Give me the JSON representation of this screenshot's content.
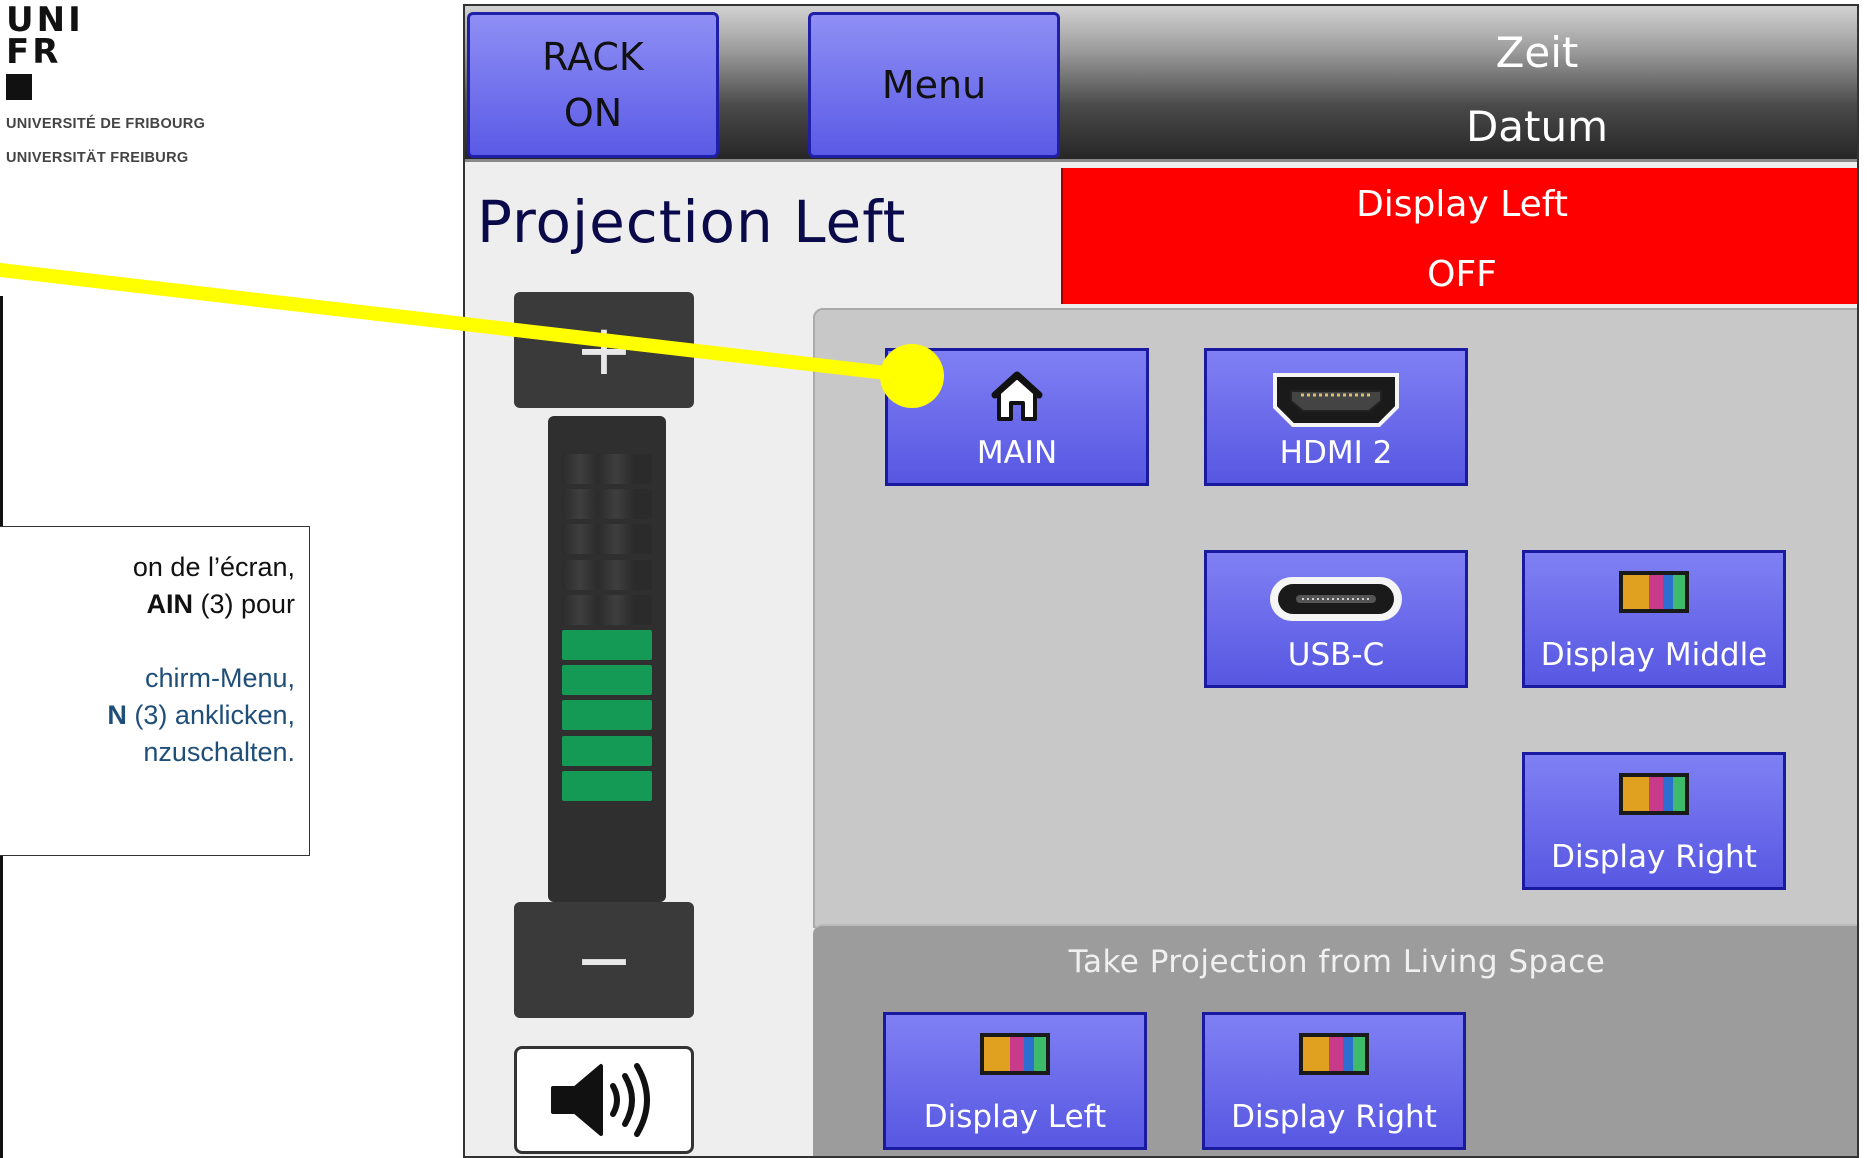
{
  "logo": {
    "wordmark_line1": "UNI",
    "wordmark_line2": "FR",
    "university_fr": "UNIVERSITÉ DE FRIBOURG",
    "university_de": "UNIVERSITÄT FREIBURG"
  },
  "note": {
    "fr_line1": "on de l’écran,",
    "fr_line2_bold": "AIN",
    "fr_line2_rest": " (3) pour",
    "de_line1": "chirm-Menu,",
    "de_line2_bold": "N",
    "de_line2_rest": " (3) anklicken,",
    "de_line3": "nzuschalten."
  },
  "topbar": {
    "rack_line1": "RACK",
    "rack_line2": "ON",
    "menu_label": "Menu",
    "time_label": "Zeit",
    "date_label": "Datum"
  },
  "panel": {
    "title": "Projection Left",
    "status_title": "Display Left",
    "status_value": "OFF"
  },
  "volume": {
    "plus_label": "+",
    "minus_label": "−",
    "level_segments_total": 10,
    "level_segments_on": 5
  },
  "sources": {
    "main_label": "MAIN",
    "hdmi2_label": "HDMI 2",
    "usbc_label": "USB-C",
    "display_middle_label": "Display Middle",
    "display_right_label": "Display Right"
  },
  "take": {
    "heading": "Take Projection from Living Space",
    "display_left_label": "Display Left",
    "display_right_label": "Display Right"
  },
  "colors": {
    "button_blue": "#6a6aee",
    "status_red": "#ff0000",
    "meter_green": "#159a55",
    "pointer_yellow": "#ffff00"
  }
}
